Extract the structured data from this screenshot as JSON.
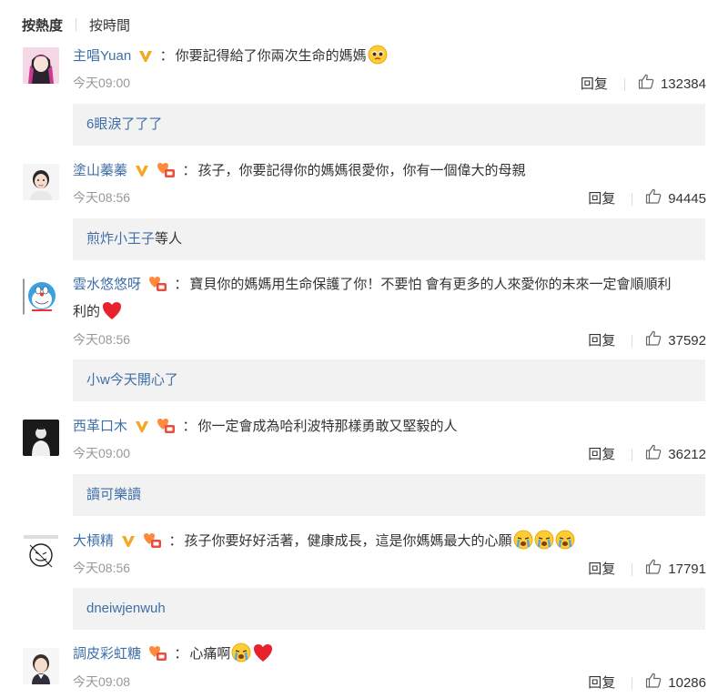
{
  "sort": {
    "active": "按熱度",
    "other": "按時間"
  },
  "icons": {
    "verified": "v-badge-icon",
    "fan": "fan-badge-icon",
    "like": "thumbs-up-icon",
    "heart": "red-heart-emoji",
    "crying": "crying-emoji",
    "pleading": "pleading-emoji"
  },
  "colors": {
    "link": "#3f6fa8",
    "verified": "#f6a623",
    "reply_bg": "#f2f2f2"
  },
  "comments": [
    {
      "user": "主唱Yuan",
      "colon": "：",
      "text": "你要記得給了你兩次生命的媽媽",
      "time": "今天09:00",
      "reply_label": "回复",
      "likes": "132384",
      "reply": "6眼淚了了了",
      "reply_suffix": ""
    },
    {
      "user": "塗山蓁蓁",
      "colon": "：",
      "text": "孩子，你要記得你的媽媽很愛你，你有一個偉大的母親",
      "time": "今天08:56",
      "reply_label": "回复",
      "likes": "94445",
      "reply": "煎炸小王子",
      "reply_suffix": "等人"
    },
    {
      "user": "雲水悠悠呀",
      "colon": "：",
      "text": "寶貝你的媽媽用生命保護了你！不要怕 會有更多的人來愛你的未來一定會順順利",
      "text2": "利的",
      "time": "今天08:56",
      "reply_label": "回复",
      "likes": "37592",
      "reply": "小w今天開心了",
      "reply_suffix": ""
    },
    {
      "user": "西革口木",
      "colon": "：",
      "text": "你一定會成為哈利波特那樣勇敢又堅毅的人",
      "time": "今天09:00",
      "reply_label": "回复",
      "likes": "36212",
      "reply": "讀可樂讀",
      "reply_suffix": ""
    },
    {
      "user": "大槓精",
      "colon": "：",
      "text": "孩子你要好好活著，健康成長，這是你媽媽最大的心願",
      "time": "今天08:56",
      "reply_label": "回复",
      "likes": "17791",
      "reply": "dneiwjenwuh",
      "reply_suffix": ""
    },
    {
      "user": "調皮彩虹糖",
      "colon": "：",
      "text": "心痛啊",
      "time": "今天09:08",
      "reply_label": "回复",
      "likes": "10286"
    }
  ]
}
